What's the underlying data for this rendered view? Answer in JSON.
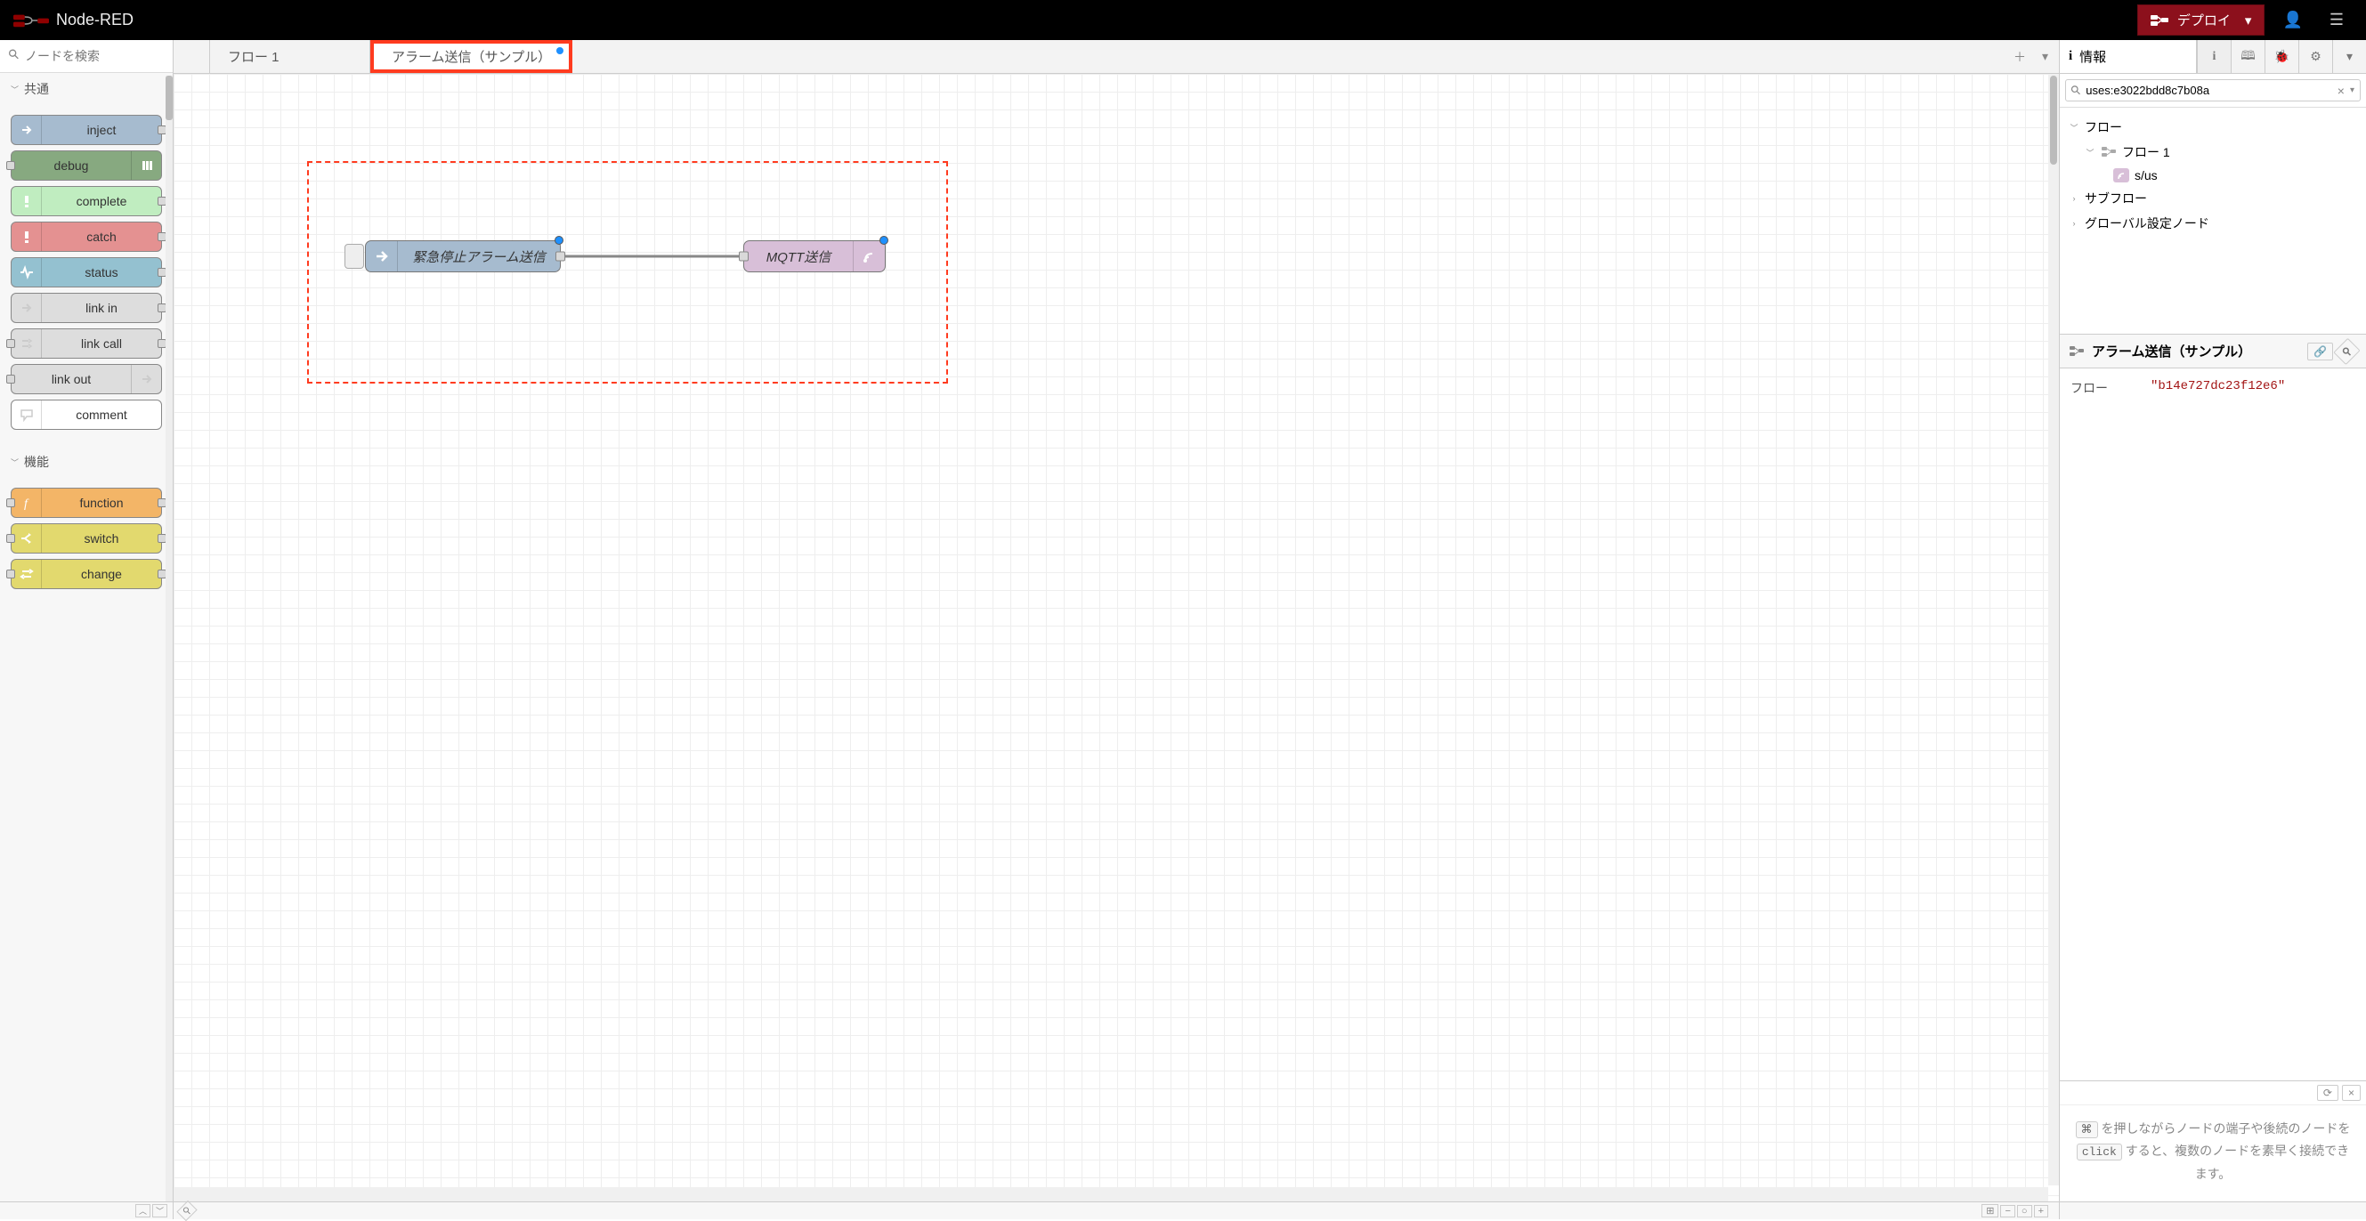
{
  "header": {
    "app_name": "Node-RED",
    "deploy_label": "デプロイ"
  },
  "palette": {
    "search_placeholder": "ノードを検索",
    "categories": [
      {
        "label": "共通",
        "nodes": [
          {
            "label": "inject",
            "kind": "inject"
          },
          {
            "label": "debug",
            "kind": "debug"
          },
          {
            "label": "complete",
            "kind": "complete"
          },
          {
            "label": "catch",
            "kind": "catch"
          },
          {
            "label": "status",
            "kind": "status"
          },
          {
            "label": "link in",
            "kind": "link-in"
          },
          {
            "label": "link call",
            "kind": "link-call"
          },
          {
            "label": "link out",
            "kind": "link-out"
          },
          {
            "label": "comment",
            "kind": "comment"
          }
        ]
      },
      {
        "label": "機能",
        "nodes": [
          {
            "label": "function",
            "kind": "function"
          },
          {
            "label": "switch",
            "kind": "switch"
          },
          {
            "label": "change",
            "kind": "change"
          }
        ]
      }
    ]
  },
  "tabs": [
    {
      "label": "フロー 1",
      "active": false,
      "highlighted": false
    },
    {
      "label": "アラーム送信（サンプル）",
      "active": true,
      "highlighted": true,
      "dirty": true
    }
  ],
  "canvas": {
    "nodes": {
      "inject": {
        "label": "緊急停止アラーム送信"
      },
      "mqtt": {
        "label": "MQTT送信"
      }
    }
  },
  "sidebar": {
    "info_title": "情報",
    "search_value": "uses:e3022bdd8c7b08a",
    "tree": {
      "flows_label": "フロー",
      "flow1_label": "フロー 1",
      "node_label": "s/us",
      "subflows_label": "サブフロー",
      "global_label": "グローバル設定ノード"
    },
    "info": {
      "header": "アラーム送信（サンプル）",
      "flow_key": "フロー",
      "flow_id": "\"b14e727dc23f12e6\""
    },
    "hint": {
      "pre": "を押しながらノードの端子や後続のノードを",
      "key1": "⌘",
      "key2": "click",
      "post": "すると、複数のノードを素早く接続できます。"
    }
  }
}
